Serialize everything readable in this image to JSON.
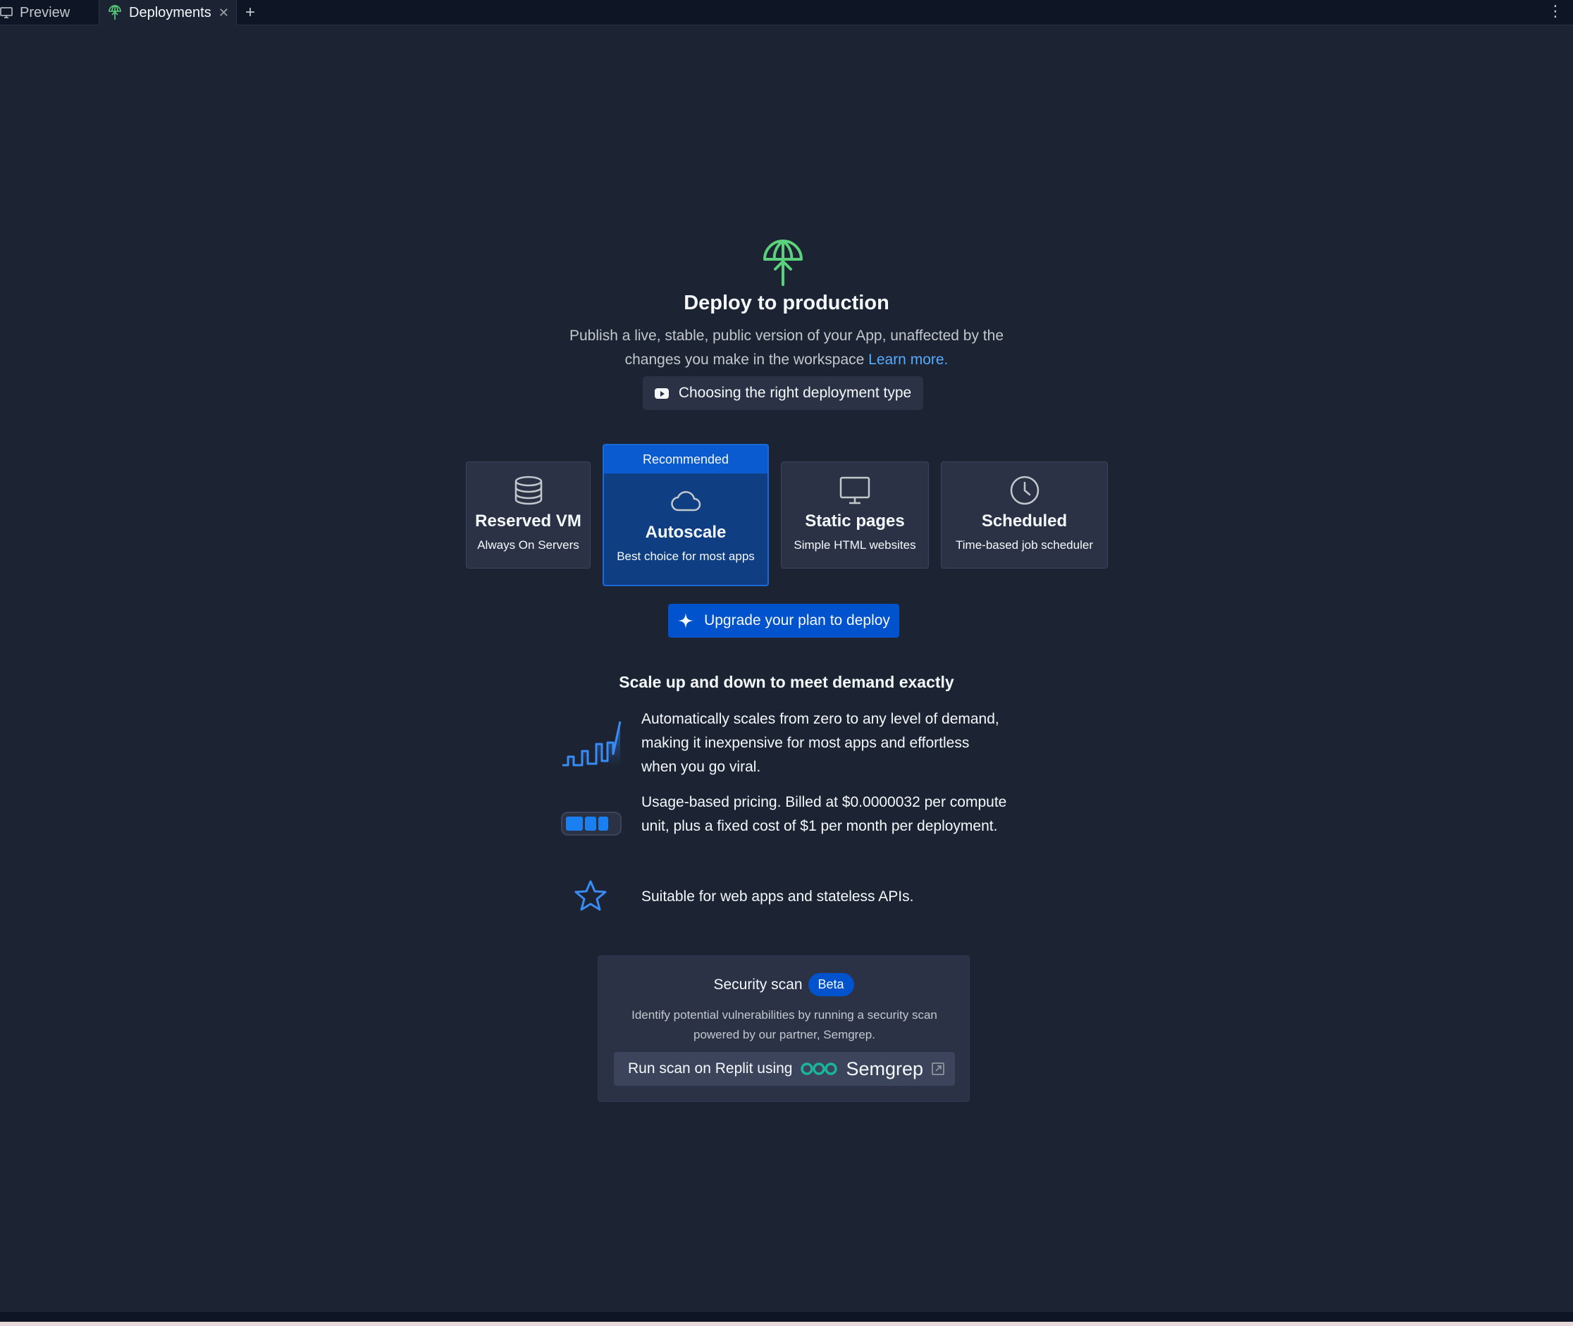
{
  "tabs": [
    {
      "label": "Preview",
      "icon": "monitor-icon"
    },
    {
      "label": "Deployments",
      "icon": "deploy-icon",
      "active": true
    }
  ],
  "hero": {
    "title": "Deploy to production",
    "subtitle": "Publish a live, stable, public version of your App, unaffected by the changes you make in the workspace",
    "learn_more": "Learn more.",
    "video_button": "Choosing the right deployment type"
  },
  "deployment_types": [
    {
      "name": "Reserved VM",
      "description": "Always On Servers",
      "icon": "database-icon"
    },
    {
      "name": "Autoscale",
      "description": "Best choice for most apps",
      "icon": "cloud-icon",
      "badge": "Recommended",
      "selected": true
    },
    {
      "name": "Static pages",
      "description": "Simple HTML websites",
      "icon": "monitor-icon"
    },
    {
      "name": "Scheduled",
      "description": "Time-based job scheduler",
      "icon": "clock-icon"
    }
  ],
  "upgrade_button": "Upgrade your plan to deploy",
  "details": {
    "title": "Scale up and down to meet demand exactly",
    "features": [
      {
        "icon": "scaling-graph-icon",
        "text": "Automatically scales from zero to any level of demand, making it inexpensive for most apps and effortless when you go viral."
      },
      {
        "icon": "battery-icon",
        "text": "Usage-based pricing. Billed at $0.0000032 per compute unit, plus a fixed cost of $1 per month per deployment."
      },
      {
        "icon": "star-icon",
        "text": "Suitable for web apps and stateless APIs."
      }
    ]
  },
  "security": {
    "title": "Security scan",
    "badge": "Beta",
    "description": "Identify potential vulnerabilities by running a security scan powered by our partner, Semgrep.",
    "button_prefix": "Run scan on Replit using",
    "button_brand": "Semgrep"
  },
  "colors": {
    "background": "#1c2333",
    "surface": "#2b3245",
    "accent": "#0053cc",
    "link": "#57abff",
    "deploy_green": "#5ad17a",
    "semgrep_teal": "#19b49b"
  }
}
